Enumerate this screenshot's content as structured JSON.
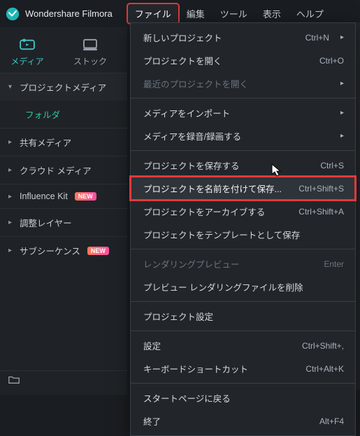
{
  "app": {
    "title": "Wondershare Filmora"
  },
  "menubar": {
    "file": "ファイル",
    "edit": "編集",
    "tools": "ツール",
    "view": "表示",
    "help": "ヘルプ"
  },
  "sidebar": {
    "tabs": {
      "media": "メディア",
      "stock": "ストック"
    },
    "sections": {
      "project_media": "プロジェクトメディア",
      "folder": "フォルダ",
      "shared_media": "共有メディア",
      "cloud_media": "クラウド メディア",
      "influence_kit": "Influence Kit",
      "adjustment_layer": "調整レイヤー",
      "subsequence": "サブシーケンス"
    },
    "badges": {
      "new": "NEW"
    }
  },
  "dropdown": {
    "new_project": {
      "label": "新しいプロジェクト",
      "kbd": "Ctrl+N",
      "sub": true
    },
    "open_project": {
      "label": "プロジェクトを開く",
      "kbd": "Ctrl+O"
    },
    "open_recent": {
      "label": "最近のプロジェクトを開く",
      "sub": true,
      "disabled": true
    },
    "import_media": {
      "label": "メディアをインポート",
      "sub": true
    },
    "record_media": {
      "label": "メディアを録音/録画する",
      "sub": true
    },
    "save_project": {
      "label": "プロジェクトを保存する",
      "kbd": "Ctrl+S"
    },
    "save_as": {
      "label": "プロジェクトを名前を付けて保存...",
      "kbd": "Ctrl+Shift+S"
    },
    "archive": {
      "label": "プロジェクトをアーカイブする",
      "kbd": "Ctrl+Shift+A"
    },
    "save_template": {
      "label": "プロジェクトをテンプレートとして保存"
    },
    "render_preview": {
      "label": "レンダリングプレビュー",
      "kbd": "Enter",
      "disabled": true
    },
    "delete_render": {
      "label": "プレビュー レンダリングファイルを削除"
    },
    "project_settings": {
      "label": "プロジェクト設定"
    },
    "settings": {
      "label": "設定",
      "kbd": "Ctrl+Shift+,"
    },
    "keyboard_shortcuts": {
      "label": "キーボードショートカット",
      "kbd": "Ctrl+Alt+K"
    },
    "start_page": {
      "label": "スタートページに戻る"
    },
    "exit": {
      "label": "終了",
      "kbd": "Alt+F4"
    }
  }
}
